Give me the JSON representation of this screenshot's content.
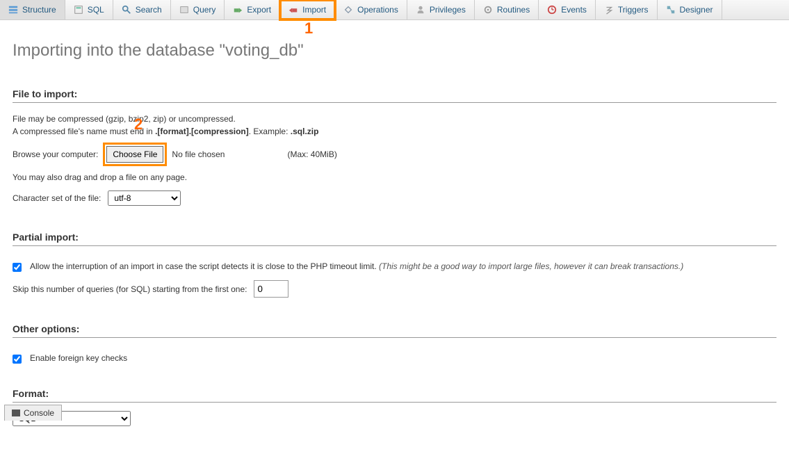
{
  "tabs": [
    {
      "label": "Structure"
    },
    {
      "label": "SQL"
    },
    {
      "label": "Search"
    },
    {
      "label": "Query"
    },
    {
      "label": "Export"
    },
    {
      "label": "Import"
    },
    {
      "label": "Operations"
    },
    {
      "label": "Privileges"
    },
    {
      "label": "Routines"
    },
    {
      "label": "Events"
    },
    {
      "label": "Triggers"
    },
    {
      "label": "Designer"
    }
  ],
  "annotations": {
    "one": "1",
    "two": "2"
  },
  "page_title": "Importing into the database \"voting_db\"",
  "file_section": {
    "legend": "File to import:",
    "help1": "File may be compressed (gzip, bzip2, zip) or uncompressed.",
    "help2_a": "A compressed file's name must end in ",
    "help2_b": ".[format].[compression]",
    "help2_c": ". Example: ",
    "help2_d": ".sql.zip",
    "browse_label": "Browse your computer:",
    "choose_file_btn": "Choose File",
    "no_file": "No file chosen",
    "max_size": "(Max: 40MiB)",
    "dragdrop": "You may also drag and drop a file on any page.",
    "charset_label": "Character set of the file:",
    "charset_value": "utf-8"
  },
  "partial_section": {
    "legend": "Partial import:",
    "allow_label_a": "Allow the interruption of an import in case the script detects it is close to the PHP timeout limit. ",
    "allow_label_b": "(This might be a good way to import large files, however it can break transactions.)",
    "skip_label": "Skip this number of queries (for SQL) starting from the first one:",
    "skip_value": "0"
  },
  "other_section": {
    "legend": "Other options:",
    "fk_label": "Enable foreign key checks"
  },
  "format_section": {
    "legend": "Format:",
    "value": "SQL"
  },
  "console": {
    "label": "Console"
  }
}
